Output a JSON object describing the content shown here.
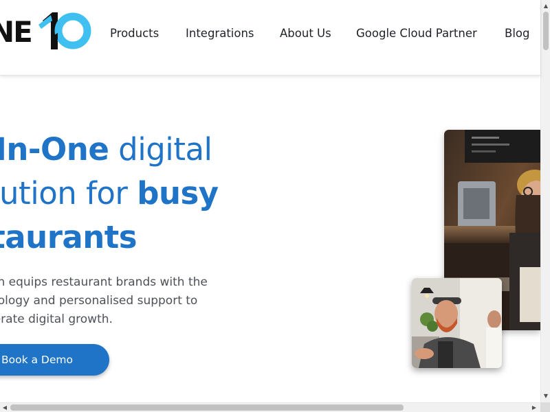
{
  "brand": {
    "logo_text": "NE",
    "logo_number": "10"
  },
  "nav": {
    "items": [
      {
        "label": "Products"
      },
      {
        "label": "Integrations"
      },
      {
        "label": "About Us"
      },
      {
        "label": "Google Cloud Partner"
      },
      {
        "label": "Blog"
      }
    ]
  },
  "hero": {
    "title_line1_bold": "l-In-One",
    "title_line1_rest": " digital",
    "title_line2_regular": "olution for ",
    "title_line2_bold": "busy",
    "title_line3_bold": "staurants",
    "desc_line1": "en equips restaurant brands with the",
    "desc_line2": "nology and personalised support to",
    "desc_line3": "lerate digital growth.",
    "cta_label": "Book a Demo"
  },
  "scrollbars": {
    "up_arrow": "▲",
    "down_arrow": "▼",
    "left_arrow": "◀",
    "right_arrow": "▶"
  },
  "colors": {
    "brand_blue": "#1f74c8",
    "logo_cyan": "#3fc0f0",
    "text_dark": "#1e2227",
    "text_gray": "#4d5258"
  }
}
